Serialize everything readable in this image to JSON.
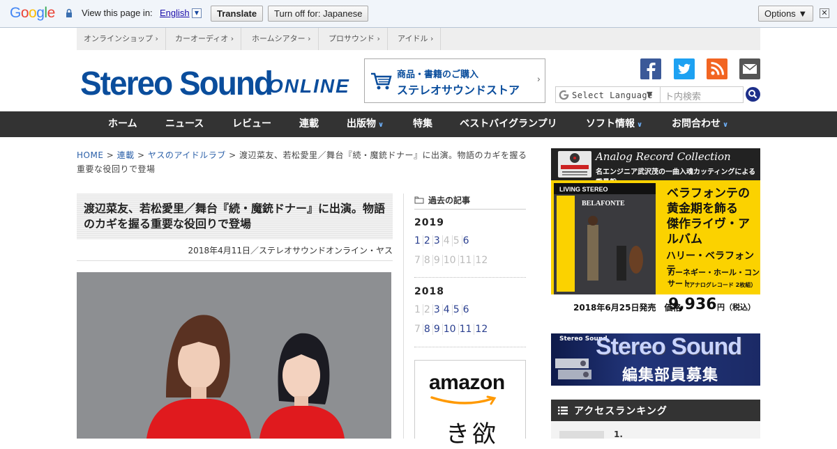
{
  "translate_bar": {
    "prompt": "View this page in:",
    "language": "English",
    "translate_label": "Translate",
    "turn_off_label": "Turn off for: Japanese",
    "options_label": "Options ▼",
    "close": "✕"
  },
  "topnav": {
    "items": [
      "オンラインショップ",
      "カーオーディオ",
      "ホームシアター",
      "プロサウンド",
      "アイドル"
    ]
  },
  "header": {
    "logo": "Stereo Sound",
    "logo_online": "ONLINE",
    "store_line1": "商品・書籍のご購入",
    "store_line2": "ステレオサウンドストア",
    "store_arrow": "›",
    "translate_select": "Select Language",
    "translate_arrow": "▼",
    "search_placeholder": "ト内検索"
  },
  "social": [
    {
      "name": "facebook-icon",
      "color": "#3b5998"
    },
    {
      "name": "twitter-icon",
      "color": "#1da1f2"
    },
    {
      "name": "rss-icon",
      "color": "#f26522"
    },
    {
      "name": "mail-icon",
      "color": "#555555"
    }
  ],
  "mainnav": {
    "items": [
      {
        "label": "ホーム",
        "dropdown": false
      },
      {
        "label": "ニュース",
        "dropdown": false
      },
      {
        "label": "レビュー",
        "dropdown": false
      },
      {
        "label": "連載",
        "dropdown": false
      },
      {
        "label": "出版物",
        "dropdown": true
      },
      {
        "label": "特集",
        "dropdown": false
      },
      {
        "label": "ベストバイグランプリ",
        "dropdown": false
      },
      {
        "label": "ソフト情報",
        "dropdown": true
      },
      {
        "label": "お問合わせ",
        "dropdown": true
      }
    ]
  },
  "breadcrumb": {
    "home": "HOME",
    "sep": ">",
    "series": "連載",
    "column": "ヤスのアイドルラブ",
    "current": "渡辺菜友、若松愛里／舞台『続・魔銃ドナー』に出演。物語のカギを握る重要な役回りで登場"
  },
  "article": {
    "title": "渡辺菜友、若松愛里／舞台『続・魔銃ドナー』に出演。物語のカギを握る重要な役回りで登場",
    "meta": "2018年4月11日／ステレオサウンドオンライン・ヤス"
  },
  "archive": {
    "heading": "過去の記事",
    "years": [
      {
        "year": "2019",
        "months": [
          {
            "m": "1",
            "active": true
          },
          {
            "m": "2",
            "active": true
          },
          {
            "m": "3",
            "active": true
          },
          {
            "m": "4",
            "active": false
          },
          {
            "m": "5",
            "active": false
          },
          {
            "m": "6",
            "active": true
          },
          {
            "m": "7",
            "active": false
          },
          {
            "m": "8",
            "active": false
          },
          {
            "m": "9",
            "active": false
          },
          {
            "m": "10",
            "active": false
          },
          {
            "m": "11",
            "active": false
          },
          {
            "m": "12",
            "active": false
          }
        ]
      },
      {
        "year": "2018",
        "months": [
          {
            "m": "1",
            "active": false
          },
          {
            "m": "2",
            "active": false
          },
          {
            "m": "3",
            "active": true
          },
          {
            "m": "4",
            "active": true
          },
          {
            "m": "5",
            "active": true
          },
          {
            "m": "6",
            "active": true
          },
          {
            "m": "7",
            "active": false
          },
          {
            "m": "8",
            "active": true
          },
          {
            "m": "9",
            "active": true
          },
          {
            "m": "10",
            "active": true
          },
          {
            "m": "11",
            "active": true
          },
          {
            "m": "12",
            "active": true
          }
        ]
      }
    ],
    "amazon_word": "amazon",
    "amazon_kana": "き欲"
  },
  "ads": {
    "record_title": "Analog Record Collection",
    "record_sub": "名エンジニア武沢茂の一曲入魂カッティングによる重量盤",
    "record_headline": "ベラフォンテの\n黄金期を飾る\n傑作ライヴ・アルバム",
    "record_artist": "ハリー・ベラフォンテ",
    "record_album": "カーネギー・ホール・コンサート",
    "record_format": "（アナログレコード 2枚組）",
    "record_date": "2018年6月25日発売　価格",
    "record_price": "9,936",
    "record_tax": "円（税込）",
    "recruit_brand": "Stereo Sound",
    "recruit_title": "Stereo Sound",
    "recruit_sub": "編集部員募集"
  },
  "ranking": {
    "heading": "アクセスランキング",
    "first": "1."
  }
}
